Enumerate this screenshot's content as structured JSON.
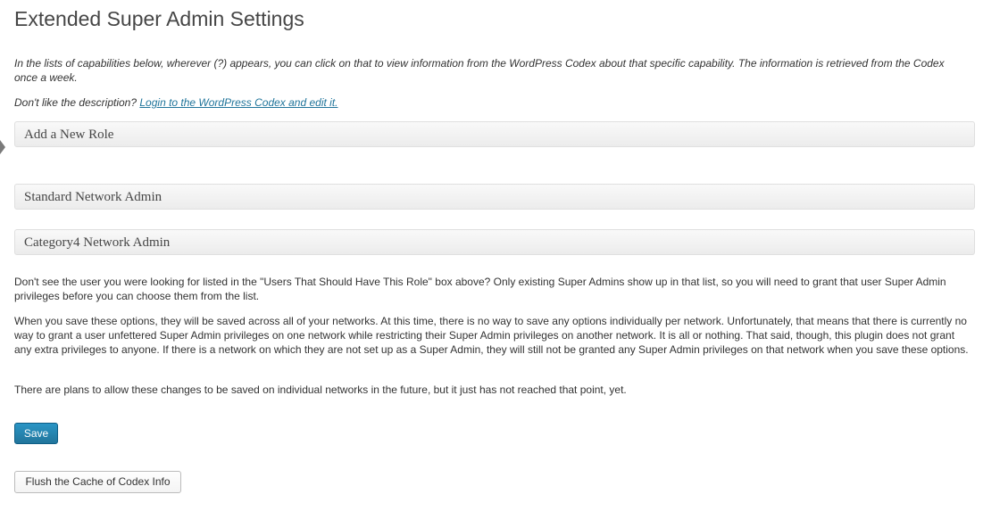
{
  "page": {
    "title": "Extended Super Admin Settings"
  },
  "intro": {
    "line1": "In the lists of capabilities below, wherever (?) appears, you can click on that to view information from the WordPress Codex about that specific capability. The information is retrieved from the Codex once a week.",
    "line2_prefix": "Don't like the description? ",
    "line2_link": "Login to the WordPress Codex and edit it."
  },
  "sections": [
    {
      "label": "Add a New Role"
    },
    {
      "label": "Standard Network Admin"
    },
    {
      "label": "Category4 Network Admin"
    }
  ],
  "paragraphs": {
    "p1": "Don't see the user you were looking for listed in the \"Users That Should Have This Role\" box above? Only existing Super Admins show up in that list, so you will need to grant that user Super Admin privileges before you can choose them from the list.",
    "p2": "When you save these options, they will be saved across all of your networks. At this time, there is no way to save any options individually per network. Unfortunately, that means that there is currently no way to grant a user unfettered Super Admin privileges on one network while restricting their Super Admin privileges on another network. It is all or nothing. That said, though, this plugin does not grant any extra privileges to anyone. If there is a network on which they are not set up as a Super Admin, they will still not be granted any Super Admin privileges on that network when you save these options.",
    "p3": "There are plans to allow these changes to be saved on individual networks in the future, but it just has not reached that point, yet."
  },
  "buttons": {
    "save": "Save",
    "flush": "Flush the Cache of Codex Info"
  },
  "colors": {
    "link": "#21759b",
    "primary_button": "#21759b"
  }
}
